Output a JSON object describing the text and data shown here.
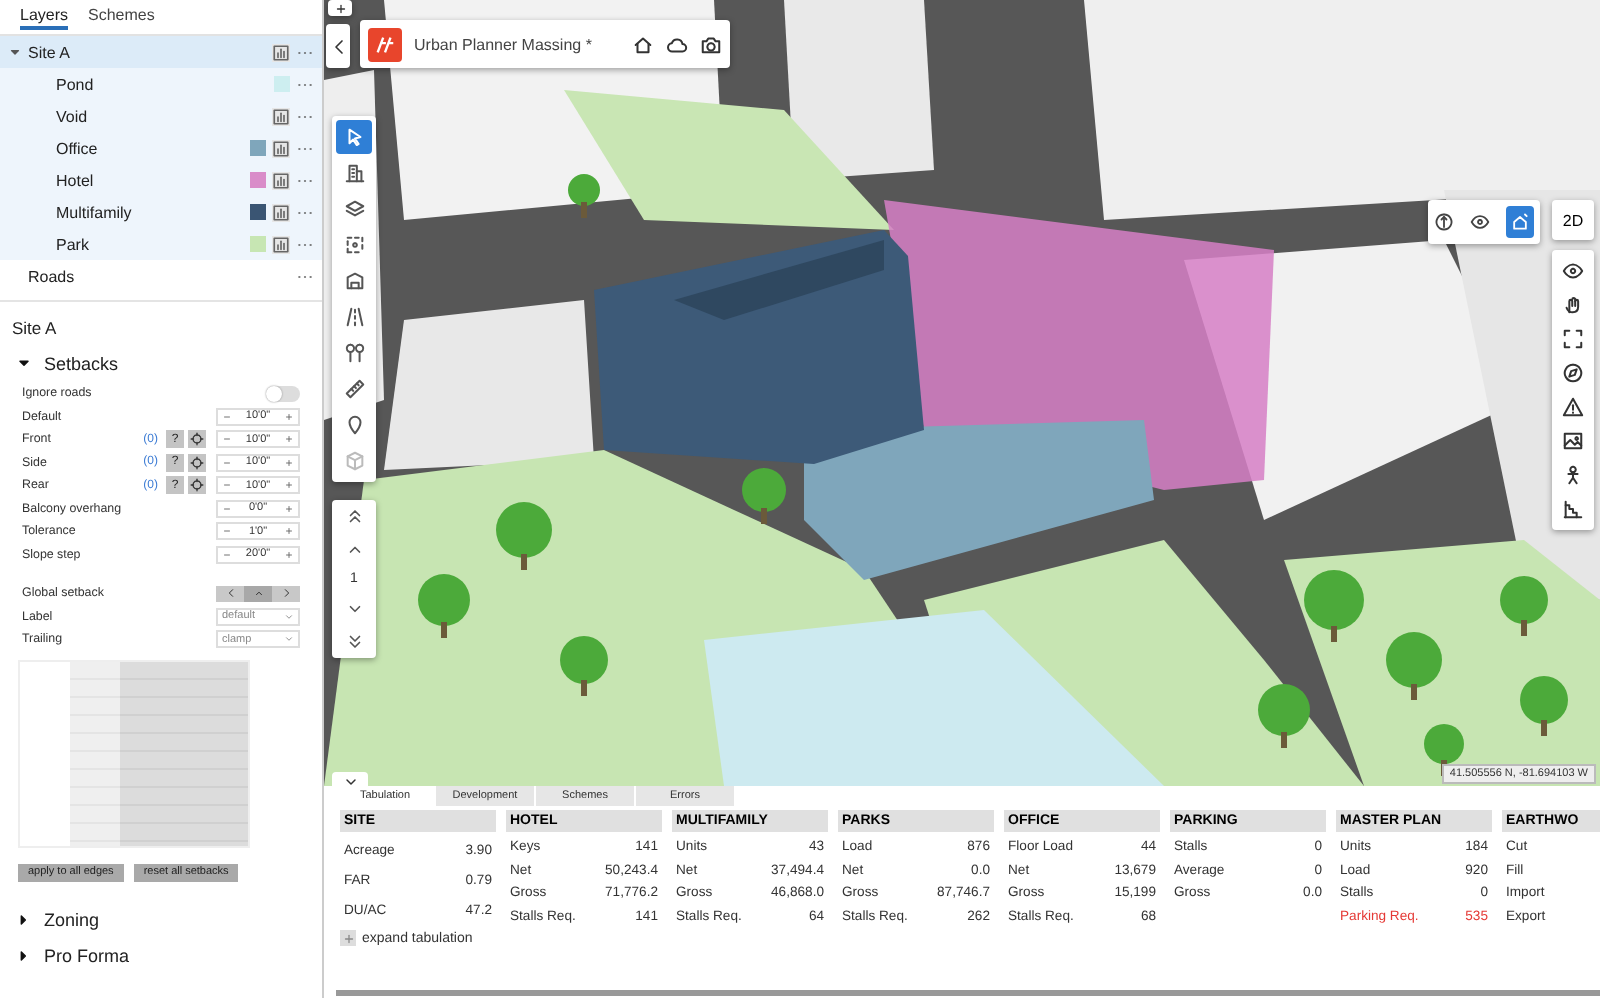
{
  "sidebar": {
    "tabs": [
      {
        "label": "Layers",
        "selected": true
      },
      {
        "label": "Schemes",
        "selected": false
      }
    ],
    "layers": [
      {
        "name": "Site A",
        "expanded": true,
        "selected": true,
        "chart": true,
        "children": [
          {
            "name": "Pond",
            "color": "#cdeef0",
            "chart": false
          },
          {
            "name": "Void",
            "chart": true
          },
          {
            "name": "Office",
            "color": "#7fa6bb",
            "chart": true
          },
          {
            "name": "Hotel",
            "color": "#d98cc9",
            "chart": true
          },
          {
            "name": "Multifamily",
            "color": "#3a5573",
            "chart": true
          },
          {
            "name": "Park",
            "color": "#c7e6b3",
            "chart": true
          }
        ]
      },
      {
        "name": "Roads",
        "chart": false
      }
    ],
    "site_title": "Site A",
    "setbacks": {
      "title": "Setbacks",
      "expanded": true,
      "fields": [
        {
          "kind": "toggle",
          "label": "Ignore roads",
          "on": false
        },
        {
          "kind": "stepper",
          "label": "Default",
          "value": "10'0\""
        },
        {
          "kind": "stepper",
          "label": "Front",
          "count": "(0)",
          "help": "?",
          "value": "10'0\""
        },
        {
          "kind": "stepper",
          "label": "Side",
          "count": "(0)",
          "help": "?",
          "value": "10'0\""
        },
        {
          "kind": "stepper",
          "label": "Rear",
          "count": "(0)",
          "help": "?",
          "value": "10'0\""
        },
        {
          "kind": "stepper",
          "label": "Balcony overhang",
          "value": "0'0\""
        },
        {
          "kind": "stepper",
          "label": "Tolerance",
          "value": "1'0\""
        },
        {
          "kind": "stepper",
          "label": "Slope step",
          "value": "20'0\""
        },
        {
          "kind": "segmented",
          "label": "Global setback",
          "options": [
            {
              "selected": false
            },
            {
              "selected": true
            },
            {
              "selected": false
            }
          ]
        },
        {
          "kind": "select",
          "label": "Label",
          "value": "default"
        },
        {
          "kind": "select",
          "label": "Trailing",
          "value": "clamp"
        }
      ],
      "buttons": [
        "apply to all edges",
        "reset all setbacks"
      ]
    },
    "more_sections": [
      {
        "title": "Zoning",
        "expanded": false
      },
      {
        "title": "Pro Forma",
        "expanded": false
      }
    ]
  },
  "viewport": {
    "title": "Urban Planner Massing *",
    "tools": [
      {
        "selected": true
      },
      {
        "selected": false
      },
      {
        "selected": false
      },
      {
        "selected": false
      },
      {
        "selected": false
      },
      {
        "selected": false
      },
      {
        "selected": false
      },
      {
        "selected": false
      },
      {
        "selected": false
      },
      {
        "selected": false
      }
    ],
    "floor": "1",
    "view_mode": "2D",
    "view_toggle": [
      {
        "selected": false
      },
      {
        "selected": true
      }
    ],
    "coordinates": "41.505556 N, -81.694103 W"
  },
  "tabulation": {
    "tabs": [
      {
        "label": "Tabulation",
        "selected": true
      },
      {
        "label": "Development",
        "selected": false
      },
      {
        "label": "Schemes",
        "selected": false
      },
      {
        "label": "Errors",
        "selected": false
      }
    ],
    "sections": [
      {
        "title": "SITE",
        "rows": [
          {
            "label": "Acreage",
            "value": "3.90",
            "alert": false
          },
          {
            "label": "FAR",
            "value": "0.79",
            "alert": false
          },
          {
            "label": "DU/AC",
            "value": "47.2",
            "alert": false
          }
        ]
      },
      {
        "title": "HOTEL",
        "rows": [
          {
            "label": "Keys",
            "value": "141",
            "alert": false
          },
          {
            "label": "Net",
            "value": "50,243.4",
            "alert": false
          },
          {
            "label": "Gross",
            "value": "71,776.2",
            "alert": false
          },
          {
            "label": "Stalls Req.",
            "value": "141",
            "alert": false
          }
        ]
      },
      {
        "title": "MULTIFAMILY",
        "rows": [
          {
            "label": "Units",
            "value": "43",
            "alert": false
          },
          {
            "label": "Net",
            "value": "37,494.4",
            "alert": false
          },
          {
            "label": "Gross",
            "value": "46,868.0",
            "alert": false
          },
          {
            "label": "Stalls Req.",
            "value": "64",
            "alert": false
          }
        ]
      },
      {
        "title": "PARKS",
        "rows": [
          {
            "label": "Load",
            "value": "876",
            "alert": false
          },
          {
            "label": "Net",
            "value": "0.0",
            "alert": false
          },
          {
            "label": "Gross",
            "value": "87,746.7",
            "alert": false
          },
          {
            "label": "Stalls Req.",
            "value": "262",
            "alert": false
          }
        ]
      },
      {
        "title": "OFFICE",
        "rows": [
          {
            "label": "Floor Load",
            "value": "44",
            "alert": false
          },
          {
            "label": "Net",
            "value": "13,679",
            "alert": false
          },
          {
            "label": "Gross",
            "value": "15,199",
            "alert": false
          },
          {
            "label": "Stalls Req.",
            "value": "68",
            "alert": false
          }
        ]
      },
      {
        "title": "PARKING",
        "rows": [
          {
            "label": "Stalls",
            "value": "0",
            "alert": false
          },
          {
            "label": "Average",
            "value": "0",
            "alert": false
          },
          {
            "label": "Gross",
            "value": "0.0",
            "alert": false
          }
        ]
      },
      {
        "title": "MASTER PLAN",
        "rows": [
          {
            "label": "Units",
            "value": "184",
            "alert": false
          },
          {
            "label": "Load",
            "value": "920",
            "alert": false
          },
          {
            "label": "Stalls",
            "value": "0",
            "alert": false
          },
          {
            "label": "Parking Req.",
            "value": "535",
            "alert": true
          }
        ]
      },
      {
        "title": "EARTHWO",
        "rows": [
          {
            "label": "Cut",
            "alert": false
          },
          {
            "label": "Fill",
            "alert": false
          },
          {
            "label": "Import",
            "alert": false
          },
          {
            "label": "Export",
            "alert": false
          }
        ]
      }
    ],
    "expand_button": "expand tabulation"
  }
}
